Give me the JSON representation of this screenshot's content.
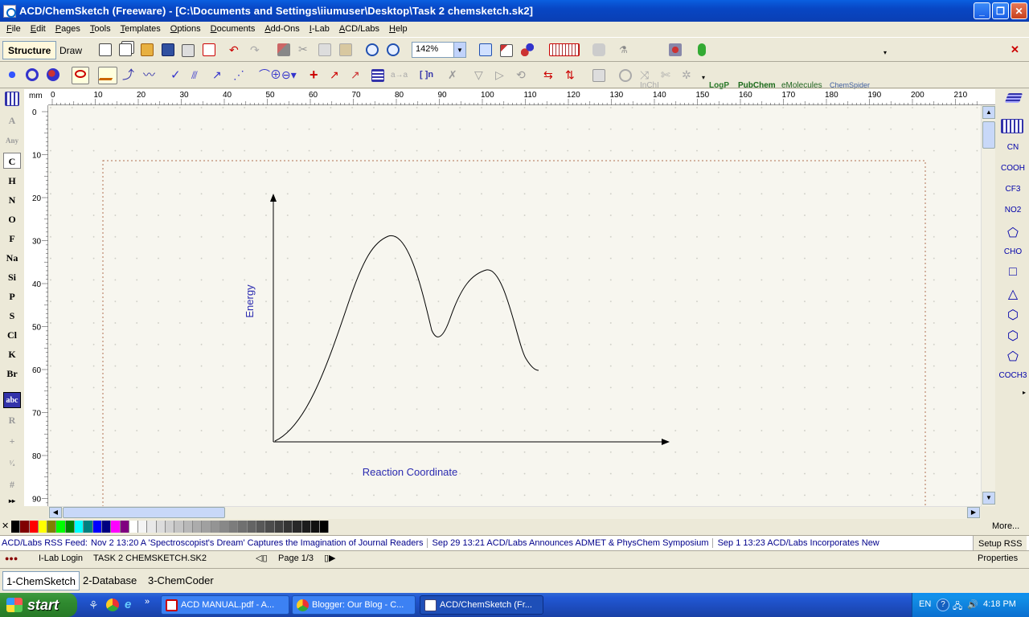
{
  "window": {
    "title": "ACD/ChemSketch (Freeware) - [C:\\Documents and Settings\\iiumuser\\Desktop\\Task 2 chemsketch.sk2]"
  },
  "menu": [
    "File",
    "Edit",
    "Pages",
    "Tools",
    "Templates",
    "Options",
    "Documents",
    "Add-Ons",
    "I-Lab",
    "ACD/Labs",
    "Help"
  ],
  "toolbar": {
    "tab_structure": "Structure",
    "tab_draw": "Draw",
    "zoom_value": "142%",
    "logp_label": "LogP",
    "pubchem_label": "PubChem",
    "emolecules_label": "eMolecules",
    "chemspider_label": "ChemSpider",
    "inchi_label": "InChI"
  },
  "left_elements": [
    "A",
    "Any",
    "C",
    "H",
    "N",
    "O",
    "F",
    "Na",
    "Si",
    "P",
    "S",
    "Cl",
    "K",
    "Br",
    "abc",
    "R",
    "+",
    "#"
  ],
  "selected_element": "C",
  "right_groups": [
    "CN",
    "COOH",
    "CF3",
    "NO2",
    "CHO",
    "COCH3"
  ],
  "ruler": {
    "unit": "mm",
    "top_ticks": [
      "0",
      "10",
      "20",
      "30",
      "40",
      "50",
      "60",
      "70",
      "80",
      "90",
      "100",
      "110",
      "120",
      "130",
      "140",
      "150",
      "160",
      "170",
      "180",
      "190",
      "200",
      "210",
      "2"
    ],
    "left_ticks": [
      "0",
      "10",
      "20",
      "30",
      "40",
      "50",
      "60",
      "70",
      "80",
      "90"
    ]
  },
  "drawing": {
    "y_label": "Energy",
    "x_label": "Reaction Coordinate"
  },
  "palette": {
    "more_label": "More..."
  },
  "rss": {
    "prefix": "ACD/Labs RSS Feed:",
    "items": [
      "Nov 2 13:20 A 'Spectroscopist's Dream' Captures the Imagination of Journal Readers",
      "Sep 29 13:21 ACD/Labs Announces ADMET & PhysChem Symposium",
      "Sep 1 13:23 ACD/Labs Incorporates New"
    ],
    "setup_label": "Setup RSS"
  },
  "status": {
    "ilab_login": "I-Lab Login",
    "document": "TASK 2 CHEMSKETCH.SK2",
    "page": "Page 1/3",
    "properties": "Properties"
  },
  "mode_tabs": [
    "1-ChemSketch",
    "2-Database",
    "3-ChemCoder"
  ],
  "taskbar": {
    "start": "start",
    "tasks": [
      "ACD MANUAL.pdf - A...",
      "Blogger: Our Blog - C...",
      "ACD/ChemSketch (Fr..."
    ],
    "lang": "EN",
    "clock": "4:18 PM"
  },
  "colors": {
    "titlebar": "#0a5fe0",
    "canvas_bg": "#f7f6ef",
    "drawing_label": "#2b2bb0",
    "rss_text": "#00008b",
    "taskbar": "#2157d4"
  }
}
